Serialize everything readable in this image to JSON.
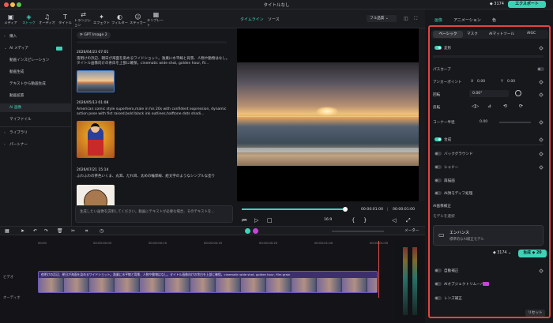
{
  "titlebar": {
    "title": "タイトルなし",
    "credits": "3174",
    "export_label": "エクスポート"
  },
  "toolbar": {
    "tools": [
      {
        "label": "メディア",
        "icon": "media-icon"
      },
      {
        "label": "ストック",
        "icon": "stock-icon"
      },
      {
        "label": "オーディオ",
        "icon": "audio-icon"
      },
      {
        "label": "タイトル",
        "icon": "title-icon"
      },
      {
        "label": "トランジション",
        "icon": "transition-icon"
      },
      {
        "label": "エフェクト",
        "icon": "effect-icon"
      },
      {
        "label": "フィルター",
        "icon": "filter-icon"
      },
      {
        "label": "ステッカー",
        "icon": "sticker-icon"
      },
      {
        "label": "テンプレート",
        "icon": "template-icon"
      }
    ]
  },
  "sidebar": {
    "items": [
      {
        "label": "購入"
      },
      {
        "label": "AI メディア"
      },
      {
        "label": "動画インスピレーション"
      },
      {
        "label": "動画生成"
      },
      {
        "label": "テキストから動画生成"
      },
      {
        "label": "動画拡張"
      },
      {
        "label": "AI 画像"
      },
      {
        "label": "マイファイル"
      },
      {
        "label": "ライブラリ"
      },
      {
        "label": "パートナー"
      }
    ]
  },
  "content": {
    "model_label": "GPT Image 2",
    "cards": [
      {
        "date": "2026/04/23 07:01",
        "text": "夜明けの浜辺、朝日が海面を染めるワイドショット。漁業に水平線と背景、人物や動物はなし。タイトル画像向けの余白を上部に確保。cinematic wide shot, golden hour, fil..."
      },
      {
        "date": "2026/05/13 01:08",
        "text": "American comic style superhero,male in his 20s with confident expression, dynamic action pose with fist raised,bold black ink outlines,halftone dots shadi..."
      },
      {
        "date": "2026/07/21 15:14",
        "text": "ふわふわの茶色いくま、丸耳、たれ目、太めの輪郭線、絵文字のようなシンプルな塗り"
      }
    ],
    "prompt_placeholder": "生成したい画像を説明してください。動画にテキストが必要な場合、そのテキストを..."
  },
  "preview": {
    "tabs": [
      "タイムライン",
      "ソース"
    ],
    "quality": "フル品質",
    "time_current": "00:00:01:00",
    "time_total": "00:00:01:00",
    "ratio": "16:9"
  },
  "right_panel": {
    "tabs": [
      "画像",
      "アニメーション",
      "色"
    ],
    "subtabs": [
      "ベーシック",
      "マスク",
      "AIマットツール",
      "AIGC"
    ],
    "sections": [
      {
        "label": "変形",
        "on": true
      },
      {
        "label": "パスカーブ"
      },
      {
        "label": "アンカーポイント",
        "value_x": "0.00",
        "value_y": "0.00"
      },
      {
        "label": "回転",
        "value": "0.00°"
      },
      {
        "label": "反転"
      },
      {
        "label": "コーナー半径",
        "value": "0.00"
      },
      {
        "label": "合成",
        "on": true
      },
      {
        "label": "バックグラウンド",
        "on": false
      },
      {
        "label": "シャドー",
        "on": false
      },
      {
        "label": "再描画",
        "on": false
      },
      {
        "label": "AI顔モディフ処理",
        "on": false
      },
      {
        "label": "AI画像補正"
      },
      {
        "label": "モデルを選択"
      },
      {
        "label": "エンハンス"
      },
      {
        "label": "自動補正",
        "on": false
      },
      {
        "label": "AIオブジェクトリムーバー",
        "on": false
      },
      {
        "label": "レンズ補正",
        "on": false
      }
    ],
    "enhance_sub": "標準的なAI補正モデル",
    "credits": "3174",
    "generate_label": "生成",
    "generate_credits": "20",
    "reset_label": "リセット"
  },
  "timeline": {
    "meter_label": "メーター",
    "ruler": [
      "00:00",
      "00:00:00:05",
      "00:00:00:10",
      "00:00:00:15",
      "00:00:00:20",
      "00:00:01:00",
      "00:00:01:05"
    ],
    "clip_text": "夜明けの浜辺、朝日が海面を染めるワイドショット。漁業に水平線と背景、人物や動物はなし。タイトル画像向けの余白を上部に確保。cinematic wide shot, golden hour, film grain",
    "track_video": "ビデオ",
    "track_audio": "オーディオ"
  }
}
